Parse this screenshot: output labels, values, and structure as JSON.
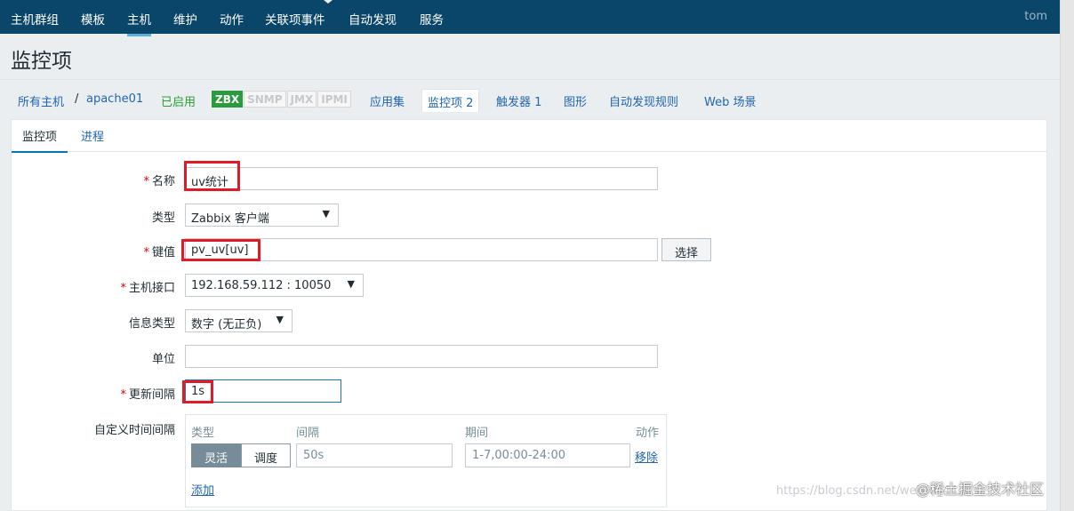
{
  "topnav": {
    "items": [
      "主机群组",
      "模板",
      "主机",
      "维护",
      "动作",
      "关联项事件",
      "自动发现",
      "服务"
    ],
    "active_index": 2,
    "user": "tom"
  },
  "page": {
    "title": "监控项"
  },
  "hostnav": {
    "all_hosts": "所有主机",
    "separator": "/",
    "host": "apache01",
    "status": "已启用",
    "badges": [
      "ZBX",
      "SNMP",
      "JMX",
      "IPMI"
    ],
    "applications": "应用集",
    "items": "监控项 2",
    "triggers": "触发器 1",
    "graphs": "图形",
    "discovery": "自动发现规则",
    "web": "Web 场景"
  },
  "tabs": {
    "items": "监控项",
    "preprocessing": "进程"
  },
  "form": {
    "required_mark": "*",
    "name": {
      "label": "名称",
      "value": "uv统计"
    },
    "type": {
      "label": "类型",
      "value": "Zabbix 客户端"
    },
    "key": {
      "label": "键值",
      "value": "pv_uv[uv]",
      "select_button": "选择"
    },
    "interface": {
      "label": "主机接口",
      "value": "192.168.59.112 : 10050"
    },
    "info_type": {
      "label": "信息类型",
      "value": "数字 (无正负)"
    },
    "units": {
      "label": "单位",
      "value": ""
    },
    "update_interval": {
      "label": "更新间隔",
      "value": "1s"
    },
    "custom_intervals": {
      "label": "自定义时间间隔",
      "headers": {
        "type": "类型",
        "interval": "间隔",
        "period": "期间",
        "action": "动作"
      },
      "type_options": [
        "灵活",
        "调度"
      ],
      "interval_value": "50s",
      "period_value": "1-7,00:00-24:00",
      "remove": "移除",
      "add": "添加"
    }
  },
  "dropdown_arrow": "▼",
  "watermarks": {
    "url": "https://blog.csdn.net/weixin_44...",
    "site": "@稀土掘金技术社区"
  },
  "colors": {
    "nav_bg": "#0a466a",
    "link": "#1f65b2",
    "required": "#d40000",
    "highlight_box": "#e01a27",
    "zbx_green": "#2c9b3f"
  }
}
